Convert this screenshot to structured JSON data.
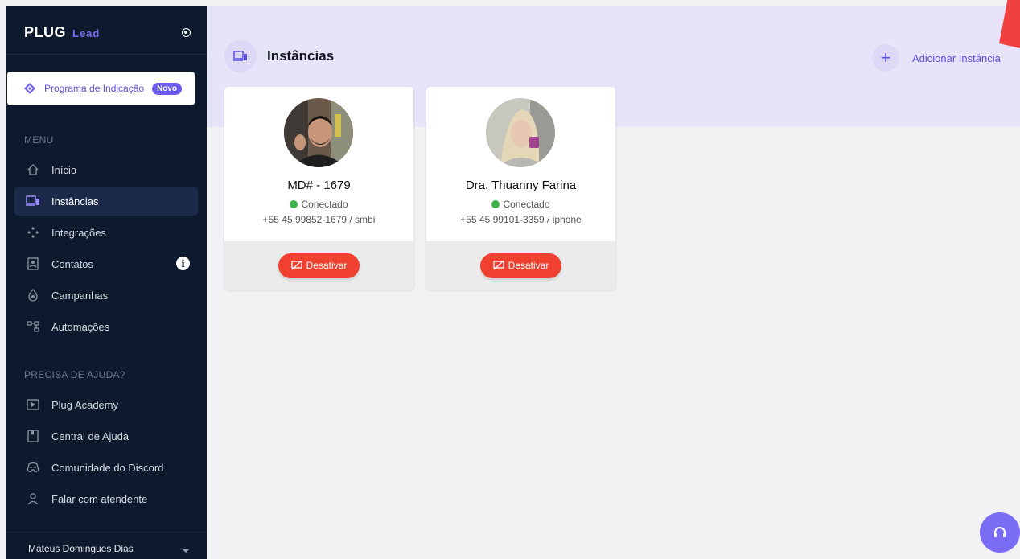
{
  "brand": {
    "name": "PLUG",
    "sub": "Lead"
  },
  "referral": {
    "label": "Programa de Indicação",
    "badge": "Novo"
  },
  "menu": {
    "title": "MENU",
    "items": [
      {
        "label": "Início",
        "icon": "home-icon"
      },
      {
        "label": "Instâncias",
        "icon": "devices-icon",
        "active": true
      },
      {
        "label": "Integrações",
        "icon": "integrations-icon"
      },
      {
        "label": "Contatos",
        "icon": "contacts-icon"
      },
      {
        "label": "Campanhas",
        "icon": "campaign-icon"
      },
      {
        "label": "Automações",
        "icon": "automation-icon"
      }
    ]
  },
  "help": {
    "title": "PRECISA DE AJUDA?",
    "items": [
      {
        "label": "Plug Academy",
        "icon": "play-icon"
      },
      {
        "label": "Central de Ajuda",
        "icon": "book-icon"
      },
      {
        "label": "Comunidade do Discord",
        "icon": "discord-icon"
      },
      {
        "label": "Falar com atendente",
        "icon": "person-icon"
      }
    ]
  },
  "user": {
    "name": "Mateus Domingues Dias"
  },
  "page": {
    "title": "Instâncias",
    "add_label": "Adicionar Instância"
  },
  "instances": [
    {
      "name": "MD# - 1679",
      "status": "Conectado",
      "phone": "+55 45 99852-1679 / smbi",
      "action": "Desativar"
    },
    {
      "name": "Dra. Thuanny Farina",
      "status": "Conectado",
      "phone": "+55 45 99101-3359 / iphone",
      "action": "Desativar"
    }
  ],
  "colors": {
    "accent": "#5d50e6",
    "danger": "#f04030",
    "success": "#3bb54a",
    "sidebar": "#0d1a2d"
  }
}
